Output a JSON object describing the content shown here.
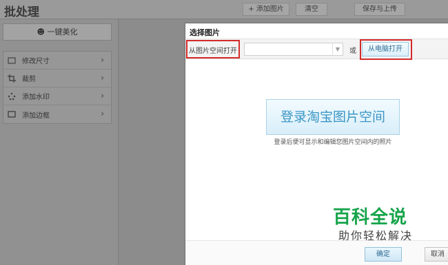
{
  "app": {
    "title": "批处理"
  },
  "header": {
    "add_label": "+ 添加图片",
    "clear_label": "清空",
    "save_label": "保存与上传"
  },
  "sidebar": {
    "beautify_label": "一键美化",
    "items": [
      {
        "label": "修改尺寸",
        "icon": "resize-icon"
      },
      {
        "label": "裁剪",
        "icon": "crop-icon"
      },
      {
        "label": "添加水印",
        "icon": "watermark-icon"
      },
      {
        "label": "添加边框",
        "icon": "border-icon"
      }
    ]
  },
  "dialog": {
    "title": "选择图片",
    "from_space_label": "从图片空间打开",
    "select_value": "",
    "or_text": "或",
    "pc_button_label": "从电脑打开",
    "login_button_label": "登录淘宝图片空间",
    "hint": "登录后便可显示和编辑您图片空间内的照片",
    "confirm_label": "确定",
    "cancel_label": "取消"
  },
  "watermark": {
    "big": "百科全说",
    "small": "助你轻松解决"
  },
  "colors": {
    "highlight": "#d42a2a",
    "accent": "#3a95c5",
    "watermark_green": "#16a44a"
  }
}
